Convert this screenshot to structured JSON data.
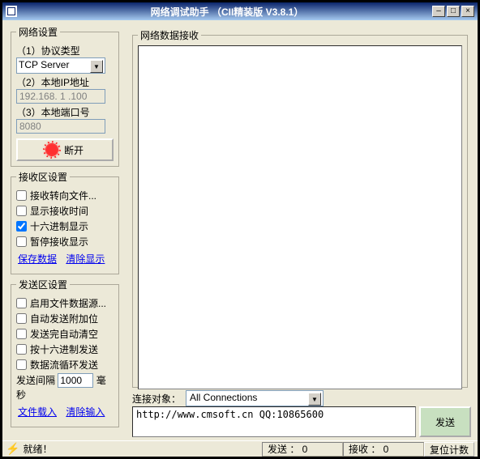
{
  "title": "网络调试助手 （CII精装版  V3.8.1）",
  "groups": {
    "net": "网络设置",
    "recvset": "接收区设置",
    "sendset": "发送区设置",
    "recv": "网络数据接收"
  },
  "net": {
    "proto_label": "（1）协议类型",
    "proto_value": "TCP Server",
    "ip_label": "（2）本地IP地址",
    "ip_value": "192.168. 1 .100",
    "port_label": "（3）本地端口号",
    "port_value": "8080",
    "disconnect": "断开"
  },
  "recvset": {
    "tofile": "接收转向文件...",
    "showtime": "显示接收时间",
    "hex": "十六进制显示",
    "pause": "暂停接收显示",
    "save": "保存数据",
    "clear": "清除显示"
  },
  "sendset": {
    "filesrc": "启用文件数据源...",
    "autoextra": "自动发送附加位",
    "autoclear": "发送完自动清空",
    "hexsend": "按十六进制发送",
    "loopsend": "数据流循环发送",
    "interval_label": "发送间隔",
    "interval_value": "1000",
    "ms": "毫秒",
    "fileload": "文件载入",
    "clearinput": "清除输入"
  },
  "conn": {
    "label": "连接对象：",
    "value": "All Connections"
  },
  "send": {
    "text": "http://www.cmsoft.cn QQ:10865600",
    "btn": "发送"
  },
  "status": {
    "ready": "就绪！",
    "sent": "发送 ： 0",
    "recv": "接收 ： 0",
    "reset": "复位计数"
  }
}
